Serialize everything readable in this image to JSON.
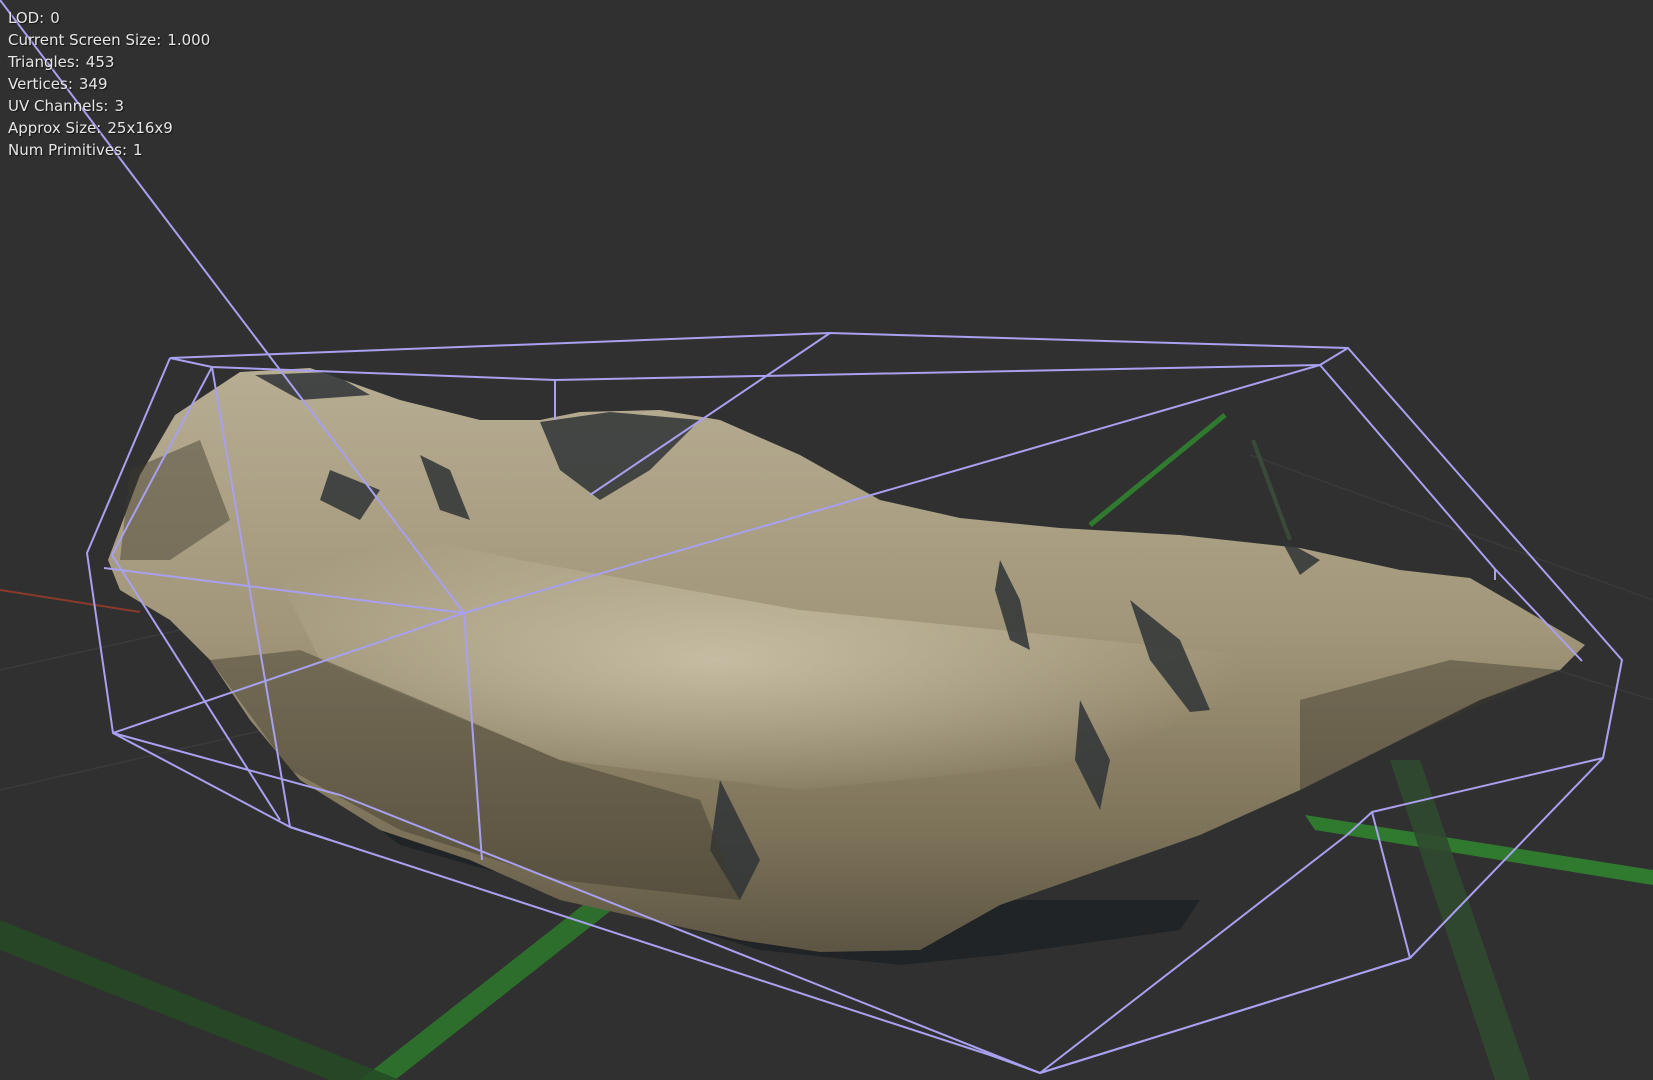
{
  "viewport": {
    "background": "#303030",
    "stats": [
      {
        "label": "LOD:",
        "value": "0"
      },
      {
        "label": "Current Screen Size:",
        "value": "1.000"
      },
      {
        "label": "Triangles:",
        "value": "453"
      },
      {
        "label": "Vertices:",
        "value": "349"
      },
      {
        "label": "UV Channels:",
        "value": "3"
      },
      {
        "label": "Approx Size:",
        "value": "25x16x9"
      },
      {
        "label": "Num Primitives:",
        "value": "1"
      }
    ]
  },
  "colors": {
    "collision_wireframe": "#a9a0ef",
    "grid_green": "#2f7a2f",
    "grid_red": "#8a3a2a",
    "rock_base": "#8c8168",
    "rock_light": "#c8bea4",
    "rock_dark": "#2e3335"
  }
}
